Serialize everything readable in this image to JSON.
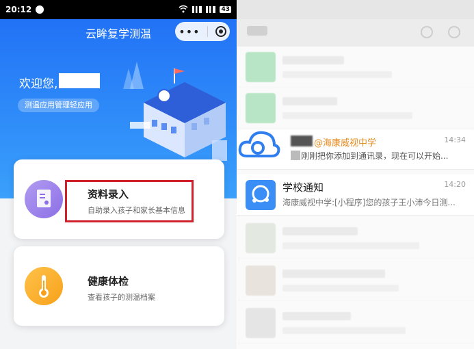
{
  "left_app": {
    "status_time": "20:12",
    "battery": "43",
    "title": "云眸复学测温",
    "capsule_menu": "•••",
    "welcome": "欢迎您,",
    "subtitle": "测温应用管理轻应用",
    "cards": [
      {
        "title": "资料录入",
        "desc": "自助录入孩子和家长基本信息",
        "icon": "id-card-icon"
      },
      {
        "title": "健康体检",
        "desc": "查看孩子的测温档案",
        "icon": "thermometer-icon"
      }
    ],
    "colors": {
      "hero_blue": "#1f6df5",
      "highlight_red": "#d0202a",
      "purple": "#8c6fe6",
      "orange": "#f7a11a"
    }
  },
  "right_app": {
    "group_chat": {
      "mention": "@海康威视中学",
      "message": "刚刚把你添加到通讯录，现在可以开始...",
      "time": "14:34"
    },
    "school_notice": {
      "name": "学校通知",
      "message": "海康威视中学:[小程序]您的孩子王小沛今日测...",
      "time": "14:20"
    }
  }
}
